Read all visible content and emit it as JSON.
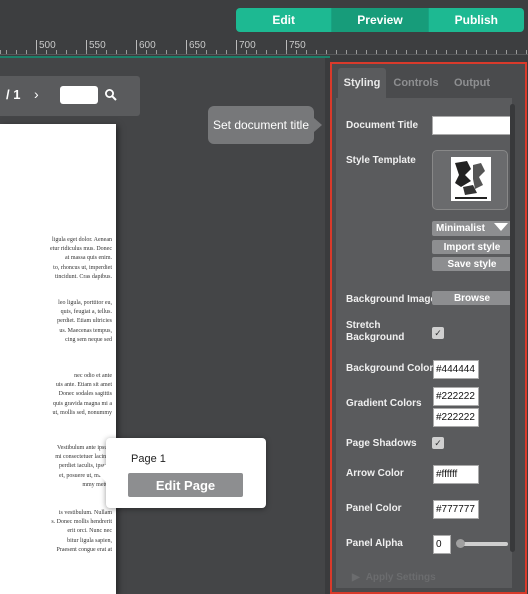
{
  "mode_switch": {
    "edit": "Edit",
    "preview": "Preview",
    "publish": "Publish"
  },
  "ruler": {
    "labels": [
      "500",
      "550",
      "600",
      "650",
      "700",
      "750"
    ]
  },
  "viewer": {
    "page_count": "/ 1",
    "next_icon": "chevron-right-icon",
    "search_icon": "search-icon",
    "page_input": ""
  },
  "document": {
    "paragraphs": [
      [
        "ligula eget dolor. Aenean",
        "etur ridiculus mus. Donec",
        "at massa quis enim.",
        "to, rhoncus ut, imperdiet",
        "tincidunt. Cras dapibus."
      ],
      [
        "leo ligula, porttitor eu,",
        "quis, feugiat a, tellus.",
        "perdiet. Etiam ultricies",
        "us. Maecenas tempus,",
        "cing sem neque sed"
      ],
      [
        "nec odio et ante",
        "uis ante. Etiam sit amet",
        "Donec sodales sagittis",
        "quis gravida magna mi a",
        "ut, mollis sed, nonummy"
      ],
      [
        "Vestibulum ante ipsum",
        "mi consectetuer lacinia.",
        "perdiet iaculis, ipsum.",
        "et, posuere ut, mauris.",
        "mmy metus."
      ],
      [
        "is vestibulum. Nullam",
        "s. Donec mollis hendrerit",
        "erit orci. Nunc nec",
        "bitur ligula sapien,",
        "Praesent congue erat at"
      ]
    ]
  },
  "tooltip": {
    "text": "Set document title"
  },
  "page_popup": {
    "title": "Page 1",
    "button": "Edit Page"
  },
  "panel": {
    "tabs": [
      "Styling",
      "Controls",
      "Output"
    ],
    "active_tab": "Styling",
    "document_title": {
      "label": "Document Title",
      "value": ""
    },
    "style_template": {
      "label": "Style Template",
      "selected": "Minimalist",
      "import_label": "Import style",
      "save_label": "Save style"
    },
    "background_image": {
      "label": "Background Image",
      "button": "Browse"
    },
    "stretch_background": {
      "label": "Stretch Background",
      "checked": true
    },
    "background_color": {
      "label": "Background Color",
      "value": "#444444"
    },
    "gradient_colors": {
      "label": "Gradient Colors",
      "value1": "#222222",
      "value2": "#222222"
    },
    "page_shadows": {
      "label": "Page Shadows",
      "checked": true
    },
    "arrow_color": {
      "label": "Arrow Color",
      "value": "#ffffff"
    },
    "panel_color": {
      "label": "Panel Color",
      "value": "#777777"
    },
    "panel_alpha": {
      "label": "Panel Alpha",
      "value": "0",
      "slider_fraction": 0.0
    },
    "apply_label": "Apply Settings"
  },
  "colors": {
    "accent": "#1db992",
    "highlight_border": "#d93a2b"
  }
}
